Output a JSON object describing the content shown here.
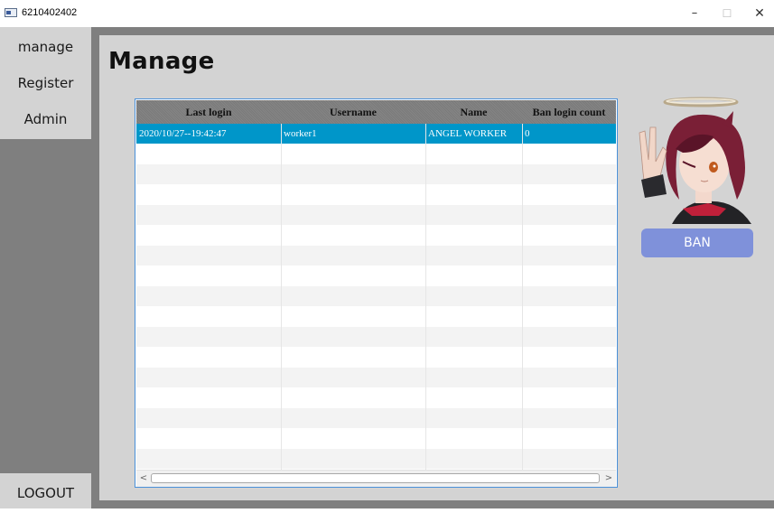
{
  "window": {
    "title": "6210402402"
  },
  "sidebar": {
    "items": [
      {
        "label": "manage"
      },
      {
        "label": "Register"
      },
      {
        "label": "Admin"
      }
    ],
    "logout_label": "LOGOUT"
  },
  "main": {
    "title": "Manage",
    "ban_label": "BAN"
  },
  "table": {
    "columns": [
      "Last login",
      "Username",
      "Name",
      "Ban login count"
    ],
    "rows": [
      [
        "2020/10/27--19:42:47",
        "worker1",
        "ANGEL WORKER",
        "0"
      ]
    ]
  },
  "colors": {
    "selected_row": "#0096c9",
    "ban_button": "#7f91da",
    "panel": "#d3d3d3",
    "frame": "#7f7f7f"
  }
}
